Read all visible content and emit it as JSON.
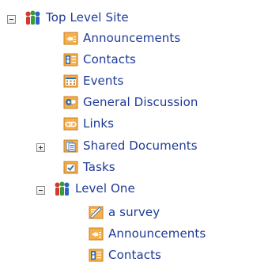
{
  "tree": {
    "nodes": [
      {
        "label": "Top Level Site",
        "icon": "site-icon"
      },
      {
        "label": "Announcements",
        "icon": "announcements-icon"
      },
      {
        "label": "Contacts",
        "icon": "contacts-icon"
      },
      {
        "label": "Events",
        "icon": "events-icon"
      },
      {
        "label": "General Discussion",
        "icon": "discussion-icon"
      },
      {
        "label": "Links",
        "icon": "links-icon"
      },
      {
        "label": "Shared Documents",
        "icon": "document-library-icon"
      },
      {
        "label": "Tasks",
        "icon": "tasks-icon"
      },
      {
        "label": "Level One",
        "icon": "site-icon"
      },
      {
        "label": "a survey",
        "icon": "survey-icon"
      },
      {
        "label": "Announcements",
        "icon": "announcements-icon"
      },
      {
        "label": "Contacts",
        "icon": "contacts-icon"
      }
    ]
  },
  "colors": {
    "link": "#1e3a96",
    "icon_orange": "#f0a341",
    "icon_blue": "#2f6cb8",
    "site_red": "#d33a2c",
    "site_green": "#3a9a3a",
    "site_blue": "#2d62c9"
  }
}
